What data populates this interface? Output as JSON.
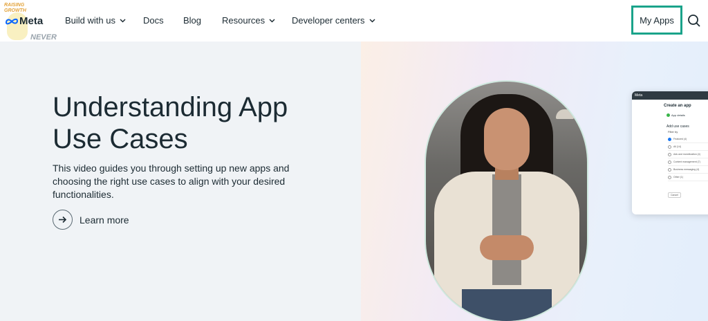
{
  "nav": {
    "brand": "Meta",
    "logo_caption": "RAISING\nGROWTH",
    "watermark": "NEVER\nLEARNING",
    "items": [
      {
        "label": "Build with us",
        "has_dropdown": true
      },
      {
        "label": "Docs",
        "has_dropdown": false
      },
      {
        "label": "Blog",
        "has_dropdown": false
      },
      {
        "label": "Resources",
        "has_dropdown": true
      },
      {
        "label": "Developer centers",
        "has_dropdown": true
      }
    ],
    "my_apps_label": "My Apps",
    "search_icon": "search-icon",
    "highlight_color": "#1aa38a"
  },
  "hero": {
    "title": "Understanding App Use Cases",
    "description": "This video guides you through setting up new apps and choosing the right use cases to align with your desired functionalities.",
    "learn_more_label": "Learn more",
    "learn_more_icon": "arrow-right-icon"
  },
  "preview_card": {
    "brand": "Meta",
    "title": "Create an app",
    "step_label": "App details",
    "section": "Add use cases",
    "filter_label": "Filter by",
    "options": [
      "Featured (4)",
      "All (14)",
      "Ads and monetization (4)",
      "Content management (7)",
      "Business messaging (4)",
      "Other (1)"
    ],
    "selected_option_index": 0,
    "button_label": "Cancel"
  },
  "colors": {
    "text": "#1c2b33",
    "background": "#f0f3f6",
    "accent_blue": "#1877f2"
  }
}
